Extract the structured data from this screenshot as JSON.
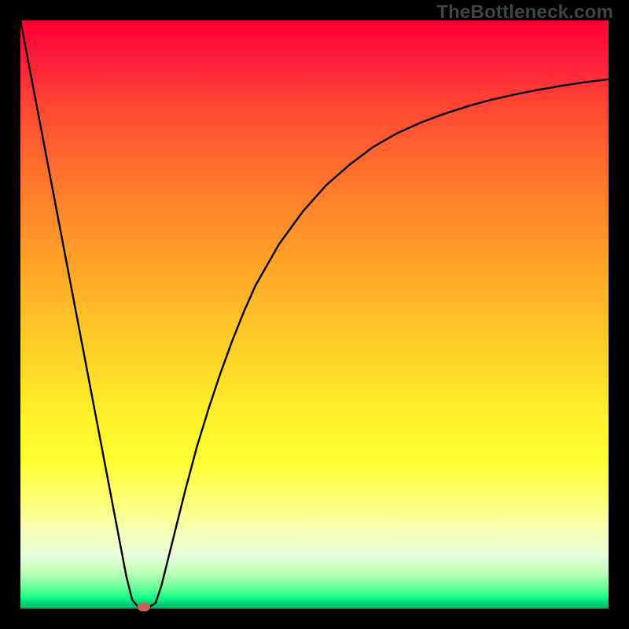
{
  "watermark": "TheBottleneck.com",
  "chart_data": {
    "type": "line",
    "title": "",
    "xlabel": "",
    "ylabel": "",
    "xlim": [
      0,
      100
    ],
    "ylim": [
      0,
      100
    ],
    "grid": false,
    "x": [
      0,
      2,
      4,
      6,
      8,
      10,
      12,
      14,
      16,
      18,
      19,
      20,
      21,
      22,
      23,
      24,
      26,
      28,
      30,
      32,
      34,
      36,
      38,
      40,
      44,
      48,
      52,
      56,
      60,
      64,
      68,
      72,
      76,
      80,
      84,
      88,
      92,
      96,
      100
    ],
    "values": [
      100,
      89.5,
      79,
      68.5,
      58,
      47.5,
      37,
      26.5,
      16,
      5.5,
      1.5,
      0.3,
      0.2,
      0.3,
      1,
      4,
      12,
      20,
      27.5,
      34,
      40,
      45.5,
      50.5,
      55,
      62,
      67.5,
      72,
      75.5,
      78.5,
      80.8,
      82.6,
      84.1,
      85.4,
      86.5,
      87.4,
      88.2,
      88.9,
      89.5,
      90
    ],
    "marker": {
      "x": 21,
      "y": 0.3
    },
    "background": "vertical-rainbow-heatmap",
    "legend": false
  }
}
